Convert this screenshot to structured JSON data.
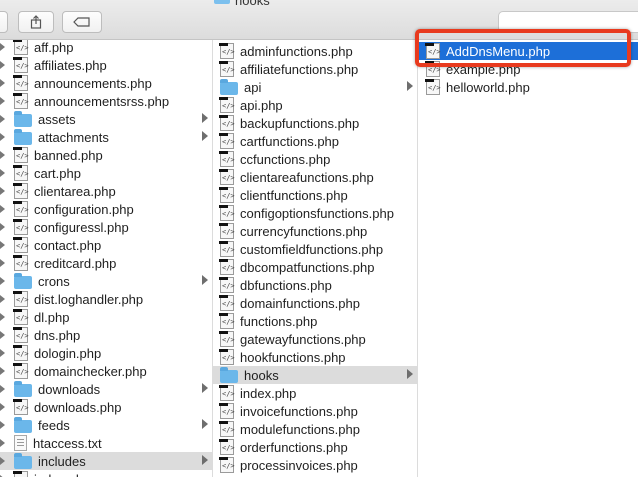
{
  "window": {
    "title": "hooks"
  },
  "column1": [
    {
      "label": "aff.php",
      "type": "php"
    },
    {
      "label": "affiliates.php",
      "type": "php"
    },
    {
      "label": "announcements.php",
      "type": "php"
    },
    {
      "label": "announcementsrss.php",
      "type": "php"
    },
    {
      "label": "assets",
      "type": "folder"
    },
    {
      "label": "attachments",
      "type": "folder"
    },
    {
      "label": "banned.php",
      "type": "php"
    },
    {
      "label": "cart.php",
      "type": "php"
    },
    {
      "label": "clientarea.php",
      "type": "php"
    },
    {
      "label": "configuration.php",
      "type": "php"
    },
    {
      "label": "configuressl.php",
      "type": "php"
    },
    {
      "label": "contact.php",
      "type": "php"
    },
    {
      "label": "creditcard.php",
      "type": "php"
    },
    {
      "label": "crons",
      "type": "folder"
    },
    {
      "label": "dist.loghandler.php",
      "type": "php"
    },
    {
      "label": "dl.php",
      "type": "php"
    },
    {
      "label": "dns.php",
      "type": "php"
    },
    {
      "label": "dologin.php",
      "type": "php"
    },
    {
      "label": "domainchecker.php",
      "type": "php"
    },
    {
      "label": "downloads",
      "type": "folder"
    },
    {
      "label": "downloads.php",
      "type": "php"
    },
    {
      "label": "feeds",
      "type": "folder"
    },
    {
      "label": "htaccess.txt",
      "type": "txt"
    },
    {
      "label": "includes",
      "type": "folder",
      "selected": true
    },
    {
      "label": "index.php",
      "type": "php"
    }
  ],
  "column2": [
    {
      "label": "adminfunctions.php",
      "type": "php"
    },
    {
      "label": "affiliatefunctions.php",
      "type": "php"
    },
    {
      "label": "api",
      "type": "folder"
    },
    {
      "label": "api.php",
      "type": "php"
    },
    {
      "label": "backupfunctions.php",
      "type": "php"
    },
    {
      "label": "cartfunctions.php",
      "type": "php"
    },
    {
      "label": "ccfunctions.php",
      "type": "php"
    },
    {
      "label": "clientareafunctions.php",
      "type": "php"
    },
    {
      "label": "clientfunctions.php",
      "type": "php"
    },
    {
      "label": "configoptionsfunctions.php",
      "type": "php"
    },
    {
      "label": "currencyfunctions.php",
      "type": "php"
    },
    {
      "label": "customfieldfunctions.php",
      "type": "php"
    },
    {
      "label": "dbcompatfunctions.php",
      "type": "php"
    },
    {
      "label": "dbfunctions.php",
      "type": "php"
    },
    {
      "label": "domainfunctions.php",
      "type": "php"
    },
    {
      "label": "functions.php",
      "type": "php"
    },
    {
      "label": "gatewayfunctions.php",
      "type": "php"
    },
    {
      "label": "hookfunctions.php",
      "type": "php"
    },
    {
      "label": "hooks",
      "type": "folder",
      "selected": true
    },
    {
      "label": "index.php",
      "type": "php"
    },
    {
      "label": "invoicefunctions.php",
      "type": "php"
    },
    {
      "label": "modulefunctions.php",
      "type": "php"
    },
    {
      "label": "orderfunctions.php",
      "type": "php"
    },
    {
      "label": "processinvoices.php",
      "type": "php"
    }
  ],
  "column3": [
    {
      "label": "AddDnsMenu.php",
      "type": "php",
      "selected": true
    },
    {
      "label": "example.php",
      "type": "php"
    },
    {
      "label": "helloworld.php",
      "type": "php"
    }
  ],
  "colors": {
    "selection_active": "#1d6fd8",
    "selection_inactive": "#dcdcdc",
    "highlight_border": "#e83a1e",
    "folder": "#6bb7ea"
  }
}
